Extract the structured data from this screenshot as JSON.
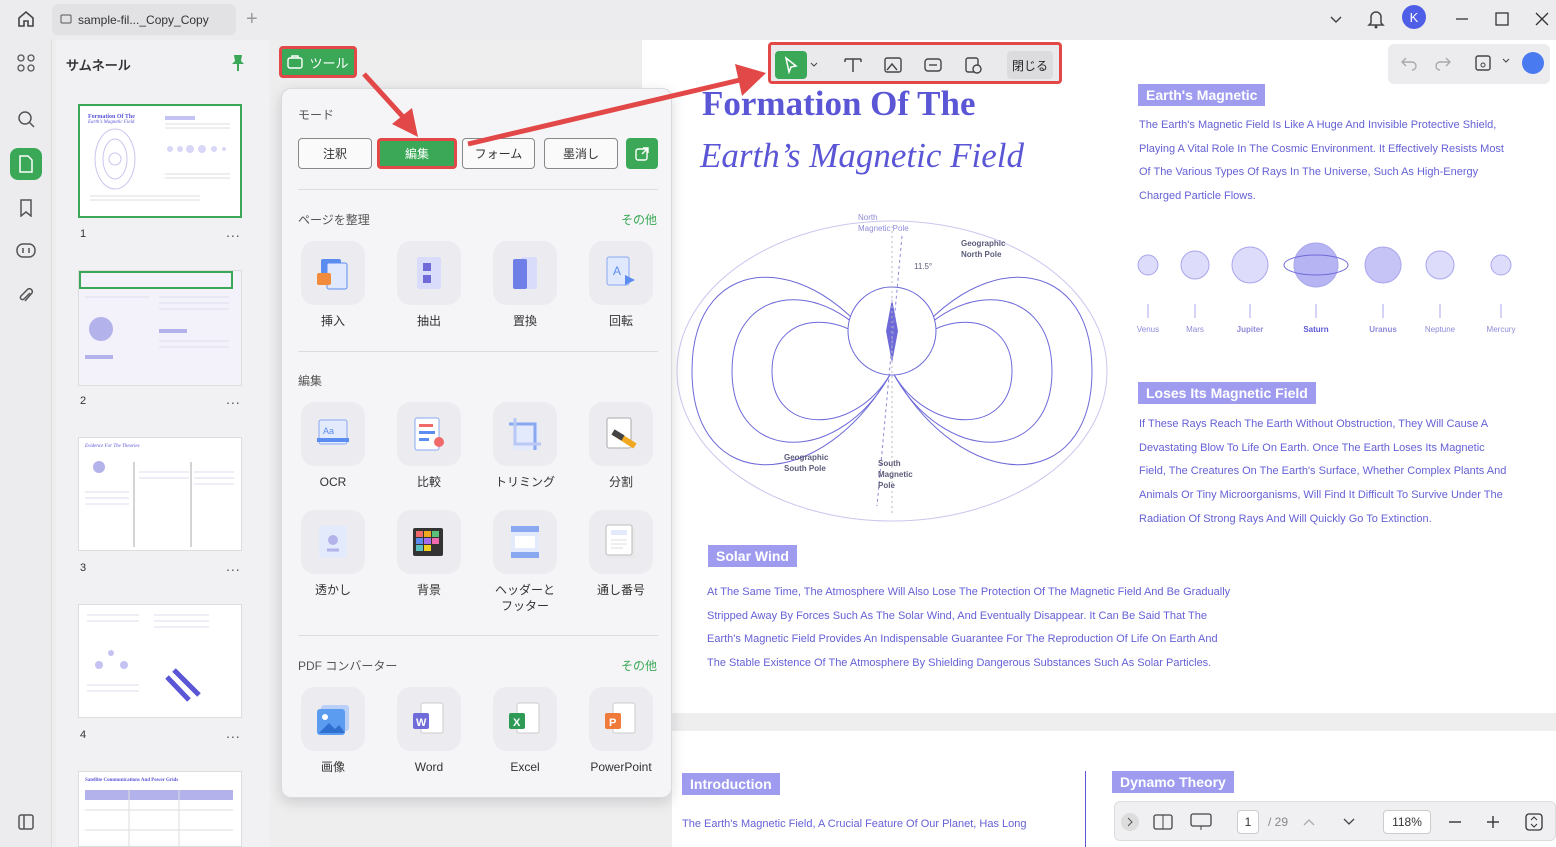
{
  "titlebar": {
    "tab_title": "sample-fil..._Copy_Copy",
    "user_initial": "K"
  },
  "thumbnails": {
    "title": "サムネール",
    "pages": [
      {
        "number": "1",
        "caption": "Formation Of The",
        "caption2": "Earth's Magnetic Field"
      },
      {
        "number": "2"
      },
      {
        "number": "3",
        "caption": "Evidence For The Theories"
      },
      {
        "number": "4"
      },
      {
        "number": "",
        "caption": "Satellite Communications And Power Grids"
      }
    ],
    "more": "..."
  },
  "tools_button": {
    "label": "ツール"
  },
  "panel": {
    "mode_header": "モード",
    "modes": [
      "注釈",
      "編集",
      "フォーム",
      "墨消し"
    ],
    "organize_header": "ページを整理",
    "organize_more": "その他",
    "organize_items": [
      "挿入",
      "抽出",
      "置換",
      "回転"
    ],
    "edit_header": "編集",
    "edit_items": [
      "OCR",
      "比較",
      "トリミング",
      "分割",
      "透かし",
      "背景",
      "ヘッダーと\nフッター",
      "通し番号"
    ],
    "converter_header": "PDF コンバーター",
    "converter_more": "その他",
    "converter_items": [
      "画像",
      "Word",
      "Excel",
      "PowerPoint"
    ]
  },
  "edit_toolbar": {
    "close_label": "閉じる"
  },
  "document": {
    "title_line1": "Formation Of The",
    "title_line2": "Earth’s Magnetic Field",
    "diagram": {
      "north_magnetic_pole": [
        "North",
        "Magnetic Pole"
      ],
      "geographic_north_pole": [
        "Geographic",
        "North Pole"
      ],
      "geographic_south_pole": [
        "Geographic",
        "South Pole"
      ],
      "south_magnetic_pole": [
        "South",
        "Magnetic",
        "Pole"
      ],
      "angle": "11.5°"
    },
    "section1_tag": "Earth's Magnetic",
    "section1_text": [
      "The Earth's Magnetic Field Is Like A Huge And Invisible Protective Shield,",
      "Playing A Vital Role In The Cosmic Environment. It Effectively Resists Most",
      "Of The Various Types Of Rays In The Universe, Such As High-Energy",
      "Charged Particle Flows."
    ],
    "planets": [
      "Venus",
      "Mars",
      "Jupiter",
      "Saturn",
      "Uranus",
      "Neptune",
      "Mercury"
    ],
    "section2_tag": "Loses Its Magnetic Field",
    "section2_text": [
      "If These Rays Reach The Earth Without Obstruction, They Will Cause A",
      "Devastating Blow To Life On Earth. Once The Earth Loses Its Magnetic",
      "Field, The Creatures On The Earth's Surface, Whether Complex Plants And",
      "Animals Or Tiny Microorganisms, Will Find It Difficult To Survive Under The",
      "Radiation Of Strong Rays And Will Quickly Go To Extinction."
    ],
    "section3_tag": "Solar Wind",
    "section3_text": [
      "At The Same Time, The Atmosphere Will Also Lose The Protection Of The Magnetic Field And Be Gradually",
      "Stripped Away By Forces Such As The Solar Wind, And Eventually Disappear. It Can Be Said That The",
      "Earth's Magnetic Field Provides An Indispensable Guarantee For The Reproduction Of Life On Earth And",
      "The Stable Existence Of The Atmosphere By Shielding Dangerous Substances Such As Solar Particles."
    ],
    "page2_intro_tag": "Introduction",
    "page2_intro_text": "The Earth's Magnetic Field, A Crucial Feature Of Our Planet, Has Long",
    "page2_dynamo_tag": "Dynamo Theory"
  },
  "bottombar": {
    "page_current": "1",
    "page_total": "/ 29",
    "zoom": "118%"
  },
  "colors": {
    "accent": "#3aa857",
    "highlight": "#e24848",
    "doc_purple": "#5b56d6"
  }
}
